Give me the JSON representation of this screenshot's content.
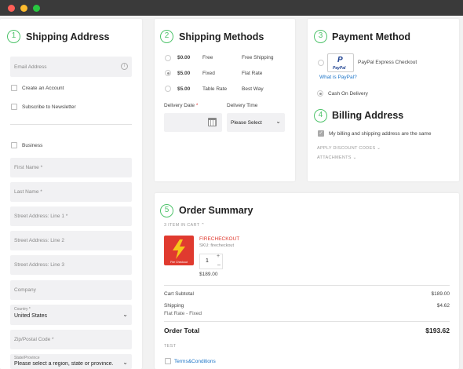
{
  "shipping_address": {
    "step": "1",
    "title": "Shipping Address",
    "email_placeholder": "Email Address",
    "create_account": "Create an Account",
    "subscribe": "Subscribe to Newsletter",
    "business": "Business",
    "first_name": "First Name *",
    "last_name": "Last Name *",
    "street1": "Street Address: Line 1 *",
    "street2": "Street Address: Line 2",
    "street3": "Street Address: Line 3",
    "company": "Company",
    "country_label": "Country *",
    "country_value": "United States",
    "zip": "Zip/Postal Code *",
    "state_label": "State/Province",
    "state_value": "Please select a region, state or province."
  },
  "shipping_methods": {
    "step": "2",
    "title": "Shipping Methods",
    "options": [
      {
        "price": "$0.00",
        "name": "Free",
        "carrier": "Free Shipping",
        "selected": false
      },
      {
        "price": "$5.00",
        "name": "Fixed",
        "carrier": "Flat Rate",
        "selected": true
      },
      {
        "price": "$5.00",
        "name": "Table Rate",
        "carrier": "Best Way",
        "selected": false
      }
    ],
    "delivery_date_label": "Delivery Date",
    "delivery_time_label": "Delivery Time",
    "delivery_time_value": "Please Select"
  },
  "payment": {
    "step": "3",
    "title": "Payment Method",
    "paypal_label": "PayPal Express Checkout",
    "paypal_logo_text": "PayPal",
    "what_is_paypal": "What is PayPal?",
    "cod_label": "Cash On Delivery"
  },
  "billing": {
    "step": "4",
    "title": "Billing Address",
    "same_address": "My billing and shipping address are the same",
    "discount": "APPLY DISCOUNT CODES",
    "attachments": "ATTACHMENTS"
  },
  "order_summary": {
    "step": "5",
    "title": "Order Summary",
    "items_in_cart": "3 ITEM IN CART",
    "product_name": "FIRECHECKOUT",
    "product_sku": "SKU: firecheckout",
    "product_image_caption": "Fire Checkout",
    "qty": "1",
    "product_price": "$189.00",
    "cart_subtotal_label": "Cart Subtotal",
    "cart_subtotal_value": "$189.00",
    "shipping_label": "Shipping",
    "shipping_method": "Flat Rate - Fixed",
    "shipping_value": "$4.62",
    "order_total_label": "Order Total",
    "order_total_value": "$193.62",
    "test_label": "TEST",
    "terms_label": "Terms&Conditions"
  },
  "colors": {
    "accent_green": "#4fc36b",
    "link_blue": "#1a73c7",
    "product_red": "#e03a2f"
  }
}
